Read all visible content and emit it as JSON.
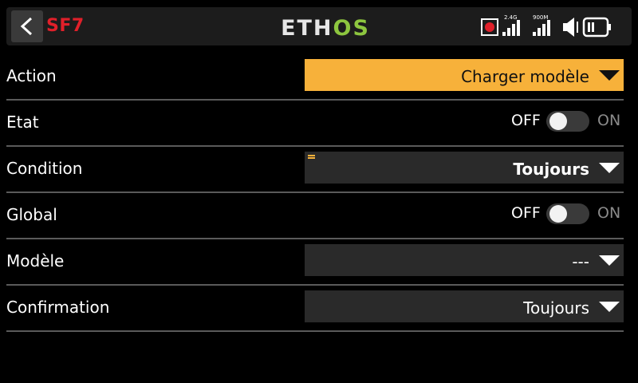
{
  "header": {
    "title": "SF7",
    "logo": "ETHOS",
    "radio_band_label": "2.4G",
    "rf_band_label": "900M",
    "icons": [
      "back-icon",
      "record-icon",
      "signal-bars-icon",
      "signal-bars-icon",
      "speaker-icon",
      "battery-icon"
    ]
  },
  "rows": {
    "action": {
      "label": "Action",
      "value": "Charger modèle"
    },
    "etat": {
      "label": "Etat",
      "off_label": "OFF",
      "on_label": "ON",
      "state": "off"
    },
    "condition": {
      "label": "Condition",
      "value": "Toujours"
    },
    "global": {
      "label": "Global",
      "off_label": "OFF",
      "on_label": "ON",
      "state": "off"
    },
    "modele": {
      "label": "Modèle",
      "value": "---"
    },
    "confirmation": {
      "label": "Confirmation",
      "value": "Toujours"
    }
  },
  "colors": {
    "accent": "#f7b13a",
    "title_red": "#e0202a",
    "logo_green": "#8dc63f",
    "record_red": "#e0202a"
  }
}
